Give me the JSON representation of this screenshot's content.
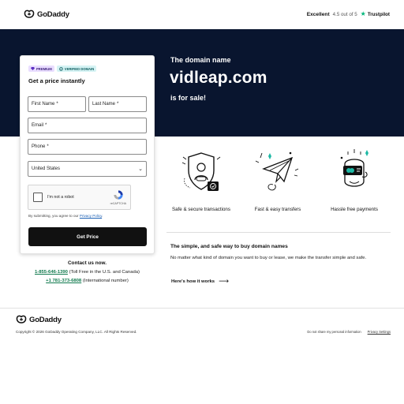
{
  "header": {
    "brand": "GoDaddy",
    "trust_rating_word": "Excellent",
    "trust_score": "4.5 out of 5",
    "trust_brand": "Trustpilot"
  },
  "hero": {
    "kicker": "The domain name",
    "domain": "vidleap.com",
    "sale": "is for sale!"
  },
  "form": {
    "badge_premium": "PREMIUM",
    "badge_verified": "VERIFIED DOMAIN",
    "title": "Get a price instantly",
    "first_name": "First Name",
    "last_name": "Last Name",
    "email": "Email",
    "phone": "Phone",
    "required_mark": "*",
    "country_value": "United States",
    "captcha_label": "I'm not a robot",
    "captcha_brand": "reCAPTCHA",
    "terms_prefix": "By submitting, you agree to our",
    "terms_link": "Privacy Policy",
    "terms_suffix": ".",
    "cta": "Get Price"
  },
  "contact": {
    "heading": "Contact us now.",
    "phone1": "1-855-646-1390",
    "phone1_note": "(Toll Free in the U.S. and Canada)",
    "phone2": "+1 781-373-6808",
    "phone2_note": "(International number)"
  },
  "features": [
    {
      "icon": "shield-icon",
      "label": "Safe & secure transactions"
    },
    {
      "icon": "paper-plane-icon",
      "label": "Fast & easy transfers"
    },
    {
      "icon": "piggy-bank-icon",
      "label": "Hassle free payments"
    }
  ],
  "info": {
    "heading": "The simple, and safe way to buy domain names",
    "body": "No matter what kind of domain you want to buy or lease, we make the transfer simple and safe.",
    "link": "Here's how it works"
  },
  "footer": {
    "brand": "GoDaddy",
    "copyright": "Copyright © 2026 GoDaddy Operating Company, LLC. All Rights Reserved.",
    "privacy_choice": "Do not share my personal information",
    "privacy_settings": "Privacy Settings"
  },
  "colors": {
    "hero_bg": "#09152f",
    "cta_bg": "#111111",
    "phone_link": "#117a4e",
    "trustpilot_green": "#00b67a",
    "feature_accent": "#1db9a5"
  }
}
